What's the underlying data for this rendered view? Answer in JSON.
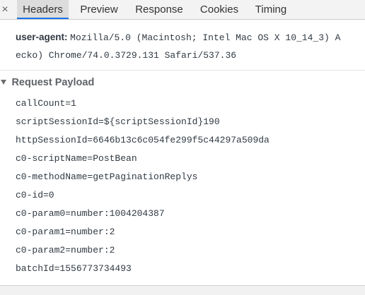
{
  "tabs": [
    {
      "label": "Headers",
      "active": true
    },
    {
      "label": "Preview",
      "active": false
    },
    {
      "label": "Response",
      "active": false
    },
    {
      "label": "Cookies",
      "active": false
    },
    {
      "label": "Timing",
      "active": false
    }
  ],
  "close_glyph": "×",
  "headers": {
    "partial_line": "— ——— ——— ————————————",
    "user_agent_key": "user-agent:",
    "user_agent_value_line1": "Mozilla/5.0 (Macintosh; Intel Mac OS X 10_14_3) A",
    "user_agent_value_line2": "ecko) Chrome/74.0.3729.131 Safari/537.36"
  },
  "payload": {
    "title": "Request Payload",
    "lines": [
      "callCount=1",
      "scriptSessionId=${scriptSessionId}190",
      "httpSessionId=6646b13c6c054fe299f5c44297a509da",
      "c0-scriptName=PostBean",
      "c0-methodName=getPaginationReplys",
      "c0-id=0",
      "c0-param0=number:1004204387",
      "c0-param1=number:2",
      "c0-param2=number:2",
      "batchId=1556773734493"
    ]
  },
  "colors": {
    "active_tab_underline": "#1a73e8",
    "tabbar_bg": "#f3f3f3"
  }
}
